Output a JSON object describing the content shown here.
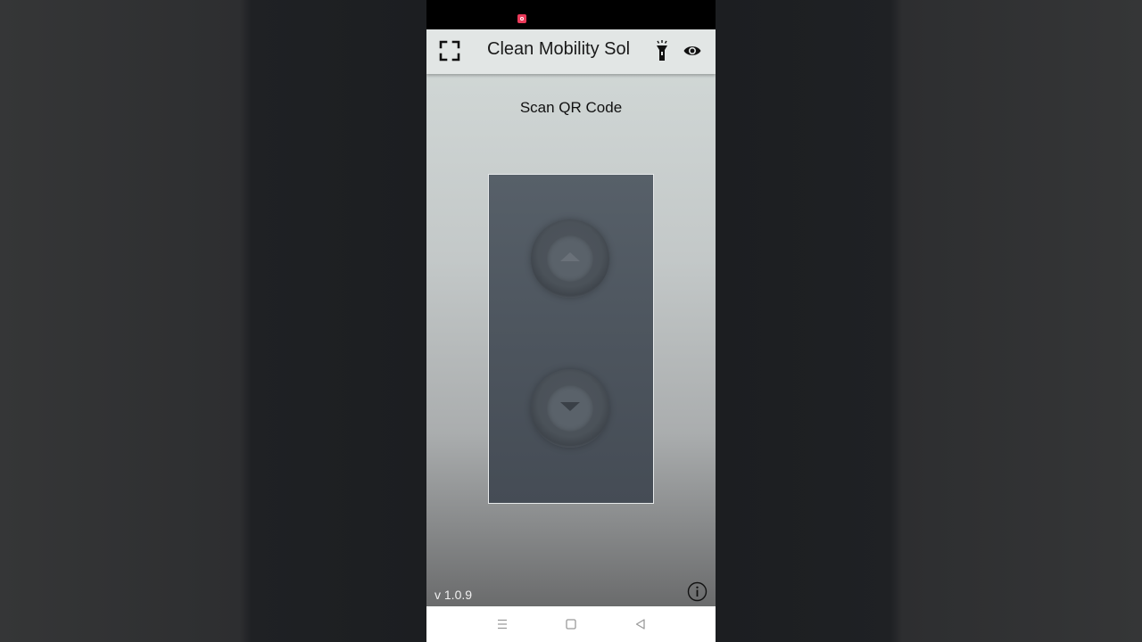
{
  "app_bar": {
    "title": "Clean Mobility Sol",
    "icons": {
      "left": "scan-frame-icon",
      "flash": "flashlight-icon",
      "view": "eye-icon"
    }
  },
  "main": {
    "scan_label": "Scan QR Code",
    "preview_controls": [
      {
        "icon": "arrow-up-icon"
      },
      {
        "icon": "arrow-down-icon"
      }
    ]
  },
  "footer": {
    "version": "v 1.0.9",
    "info_icon": "info-icon"
  },
  "system_nav": {
    "buttons": [
      "menu-icon",
      "home-icon",
      "back-icon"
    ]
  },
  "colors": {
    "accent_recording": "#ea3a5a",
    "app_bar_bg": "#e2e6e5",
    "preview_bg": "#4d555e"
  }
}
